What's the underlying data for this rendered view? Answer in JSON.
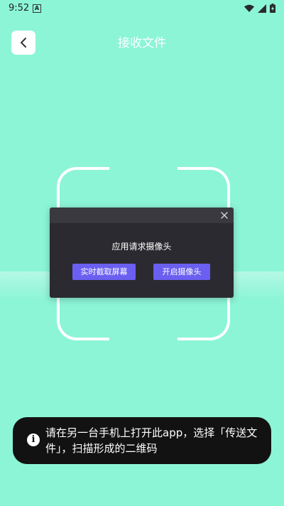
{
  "status_bar": {
    "time": "9:52",
    "notification_letter": "A",
    "icons": [
      "wifi-icon",
      "signal-icon",
      "battery-icon"
    ]
  },
  "header": {
    "title": "接收文件",
    "back_icon": "chevron-left-icon"
  },
  "dialog": {
    "message": "应用请求摄像头",
    "close_icon": "close-icon",
    "buttons": {
      "screen_capture": "实时截取屏幕",
      "open_camera": "开启摄像头"
    }
  },
  "toast": {
    "icon": "info-icon",
    "icon_glyph": "i",
    "text": "请在另一台手机上打开此app，选择「传送文件」，扫描形成的二维码"
  },
  "colors": {
    "background": "#8cf5d6",
    "dialog_bg": "#2b2a30",
    "button_accent": "#6a5ff0",
    "toast_bg": "#121212"
  }
}
